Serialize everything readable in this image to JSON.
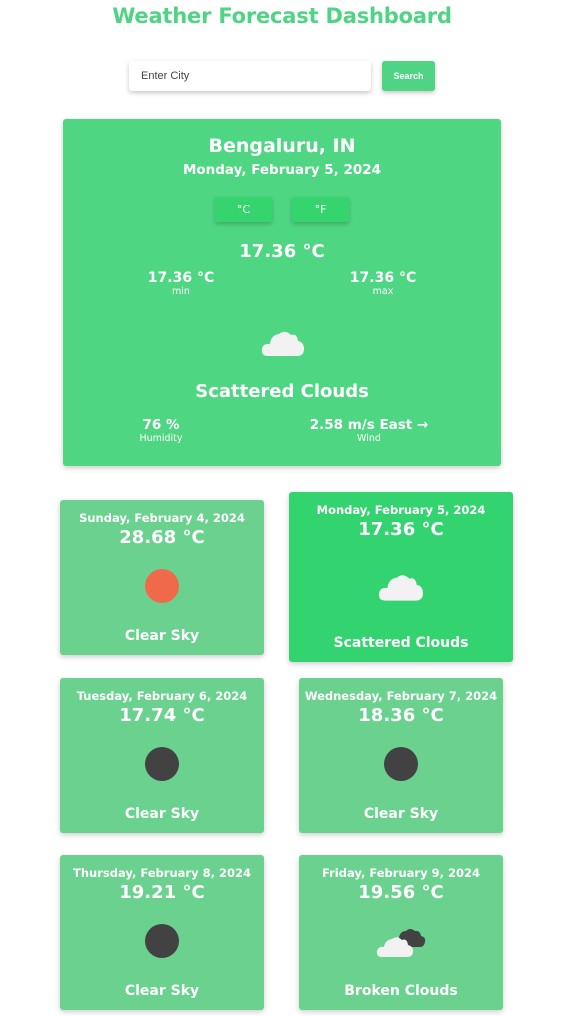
{
  "header": {
    "title": "Weather Forecast Dashboard"
  },
  "search": {
    "placeholder": "Enter City",
    "value": "",
    "button_label": "Search"
  },
  "current": {
    "city": "Bengaluru, IN",
    "date": "Monday, February 5, 2024",
    "unit_c": "°C",
    "unit_f": "°F",
    "temp": "17.36 °C",
    "min_value": "17.36 °C",
    "min_label": "min",
    "max_value": "17.36 °C",
    "max_label": "max",
    "icon": "cloud-icon",
    "description": "Scattered Clouds",
    "humidity_value": "76 %",
    "humidity_label": "Humidity",
    "wind_value": "2.58 m/s East →",
    "wind_label": "Wind"
  },
  "forecast": [
    {
      "date": "Sunday, February 4, 2024",
      "temp": "28.68 °C",
      "description": "Clear Sky",
      "icon": "sun-icon"
    },
    {
      "date": "Monday, February 5, 2024",
      "temp": "17.36 °C",
      "description": "Scattered Clouds",
      "icon": "cloud-icon"
    },
    {
      "date": "Tuesday, February 6, 2024",
      "temp": "17.74 °C",
      "description": "Clear Sky",
      "icon": "moon-icon"
    },
    {
      "date": "Wednesday, February 7, 2024",
      "temp": "18.36 °C",
      "description": "Clear Sky",
      "icon": "moon-icon"
    },
    {
      "date": "Thursday, February 8, 2024",
      "temp": "19.21 °C",
      "description": "Clear Sky",
      "icon": "moon-icon"
    },
    {
      "date": "Friday, February 9, 2024",
      "temp": "19.56 °C",
      "description": "Broken Clouds",
      "icon": "broken-clouds-icon"
    }
  ],
  "colors": {
    "accent": "#4fd483",
    "card": "#6ad28e",
    "active_card": "#33d470",
    "sun": "#f0694b",
    "moon": "#424242",
    "cloud": "#f2f2f2"
  }
}
